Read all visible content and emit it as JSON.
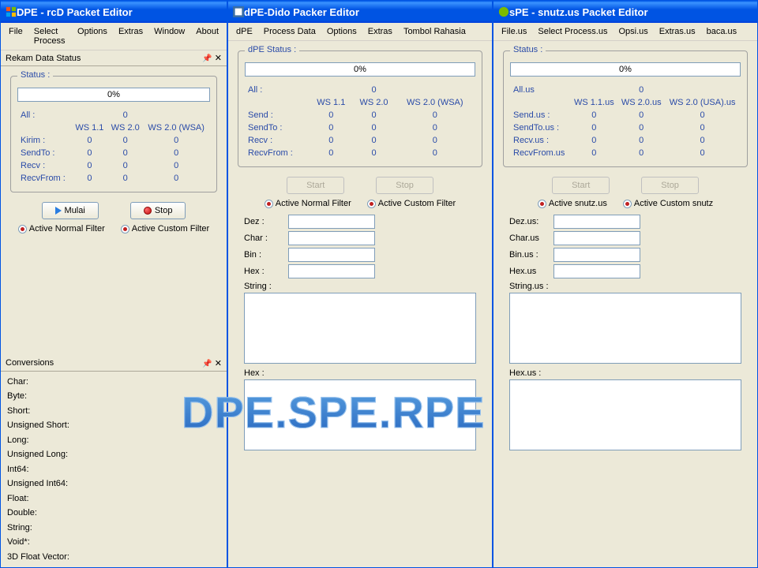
{
  "watermark": "DPE.SPE.RPE",
  "win1": {
    "title": "DPE - rcD Packet Editor",
    "menu": [
      "File",
      "Select Process",
      "Options",
      "Extras",
      "Window",
      "About"
    ],
    "panel1_title": "Rekam Data Status",
    "status_legend": "Status :",
    "progress": "0%",
    "col_all": "All :",
    "all_val": "0",
    "cols": [
      "WS 1.1",
      "WS 2.0",
      "WS 2.0 (WSA)"
    ],
    "rows": [
      [
        "Kirim :",
        "0",
        "0",
        "0"
      ],
      [
        "SendTo :",
        "0",
        "0",
        "0"
      ],
      [
        "Recv :",
        "0",
        "0",
        "0"
      ],
      [
        "RecvFrom :",
        "0",
        "0",
        "0"
      ]
    ],
    "btn_start": "Mulai",
    "btn_stop": "Stop",
    "radio1": "Active Normal Filter",
    "radio2": "Active Custom Filter",
    "panel2_title": "Conversions",
    "conv": [
      "Char:",
      "Byte:",
      "Short:",
      "Unsigned Short:",
      "Long:",
      "Unsigned Long:",
      "Int64:",
      "Unsigned Int64:",
      "Float:",
      "Double:",
      "String:",
      "Void*:",
      "3D Float Vector:"
    ]
  },
  "win2": {
    "title": "dPE-Dido Packer Editor",
    "menu": [
      "dPE",
      "Process Data",
      "Options",
      "Extras",
      "Tombol Rahasia"
    ],
    "status_legend": "dPE Status :",
    "progress": "0%",
    "col_all": "All :",
    "all_val": "0",
    "cols": [
      "WS 1.1",
      "WS 2.0",
      "WS 2.0 (WSA)"
    ],
    "rows": [
      [
        "Send :",
        "0",
        "0",
        "0"
      ],
      [
        "SendTo :",
        "0",
        "0",
        "0"
      ],
      [
        "Recv :",
        "0",
        "0",
        "0"
      ],
      [
        "RecvFrom :",
        "0",
        "0",
        "0"
      ]
    ],
    "btn_start": "Start",
    "btn_stop": "Stop",
    "radio1": "Active Normal Filter",
    "radio2": "Active Custom Filter",
    "f_dez": "Dez :",
    "f_char": "Char :",
    "f_bin": "Bin :",
    "f_hex": "Hex :",
    "f_string": "String :",
    "f_hex2": "Hex :"
  },
  "win3": {
    "title": "sPE - snutz.us Packet Editor",
    "menu": [
      "File.us",
      "Select Process.us",
      "Opsi.us",
      "Extras.us",
      "baca.us"
    ],
    "status_legend": "Status :",
    "progress": "0%",
    "col_all": "All.us",
    "all_val": "0",
    "cols": [
      "WS 1.1.us",
      "WS 2.0.us",
      "WS 2.0 (USA).us"
    ],
    "rows": [
      [
        "Send.us :",
        "0",
        "0",
        "0"
      ],
      [
        "SendTo.us :",
        "0",
        "0",
        "0"
      ],
      [
        "Recv.us :",
        "0",
        "0",
        "0"
      ],
      [
        "RecvFrom.us",
        "0",
        "0",
        "0"
      ]
    ],
    "btn_start": "Start",
    "btn_stop": "Stop",
    "radio1": "Active snutz.us",
    "radio2": "Active Custom snutz",
    "f_dez": "Dez.us:",
    "f_char": "Char.us",
    "f_bin": "Bin.us :",
    "f_hex": "Hex.us",
    "f_string": "String.us :",
    "f_hex2": "Hex.us :"
  }
}
